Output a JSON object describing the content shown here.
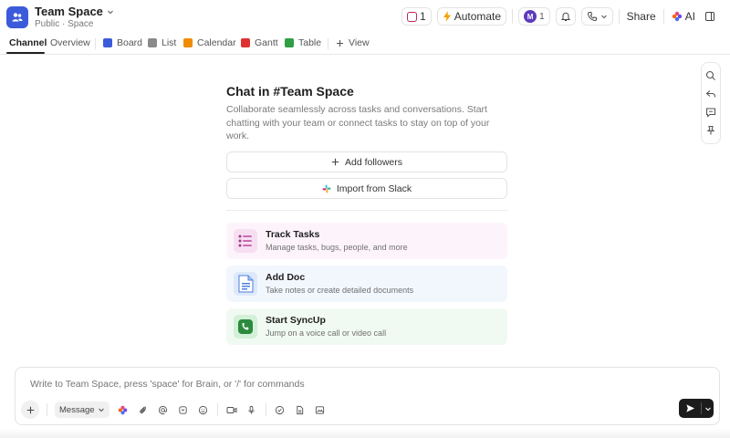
{
  "header": {
    "space_name": "Team Space",
    "space_meta": "Public · Space",
    "brain_count": "1",
    "automate_label": "Automate",
    "avatar_initial": "M",
    "avatar_count": "1",
    "share_label": "Share",
    "ai_label": "AI"
  },
  "tabs": [
    {
      "label": "Channel",
      "active": true,
      "icon": null
    },
    {
      "label": "Overview",
      "active": false,
      "icon": null
    },
    {
      "label": "Board",
      "active": false,
      "icon": "board-icon",
      "color": "#3b5bdb"
    },
    {
      "label": "List",
      "active": false,
      "icon": "list-icon",
      "color": "#777777"
    },
    {
      "label": "Calendar",
      "active": false,
      "icon": "calendar-icon",
      "color": "#f08c00"
    },
    {
      "label": "Gantt",
      "active": false,
      "icon": "gantt-icon",
      "color": "#e03131"
    },
    {
      "label": "Table",
      "active": false,
      "icon": "table-icon",
      "color": "#2f9e44"
    },
    {
      "label": "View",
      "active": false,
      "icon": "plus-icon"
    }
  ],
  "main": {
    "title": "Chat in #Team Space",
    "description": "Collaborate seamlessly across tasks and conversations. Start chatting with your team or connect tasks to stay on top of your work.",
    "add_followers_label": "Add followers",
    "import_slack_label": "Import from Slack",
    "cards": [
      {
        "title": "Track Tasks",
        "desc": "Manage tasks, bugs, people, and more",
        "bg": "#fdf4fb",
        "icon": "checklist-icon"
      },
      {
        "title": "Add Doc",
        "desc": "Take notes or create detailed documents",
        "bg": "#f2f7fe",
        "icon": "doc-icon"
      },
      {
        "title": "Start SyncUp",
        "desc": "Jump on a voice call or video call",
        "bg": "#f1faf2",
        "icon": "phone-icon"
      }
    ]
  },
  "composer": {
    "placeholder": "Write to Team Space, press 'space' for Brain, or '/' for commands",
    "message_type": "Message"
  },
  "colors": {
    "accent": "#3b5bdb",
    "text": "#202020",
    "muted": "#7a7a7a",
    "border": "#e3e3e3"
  }
}
